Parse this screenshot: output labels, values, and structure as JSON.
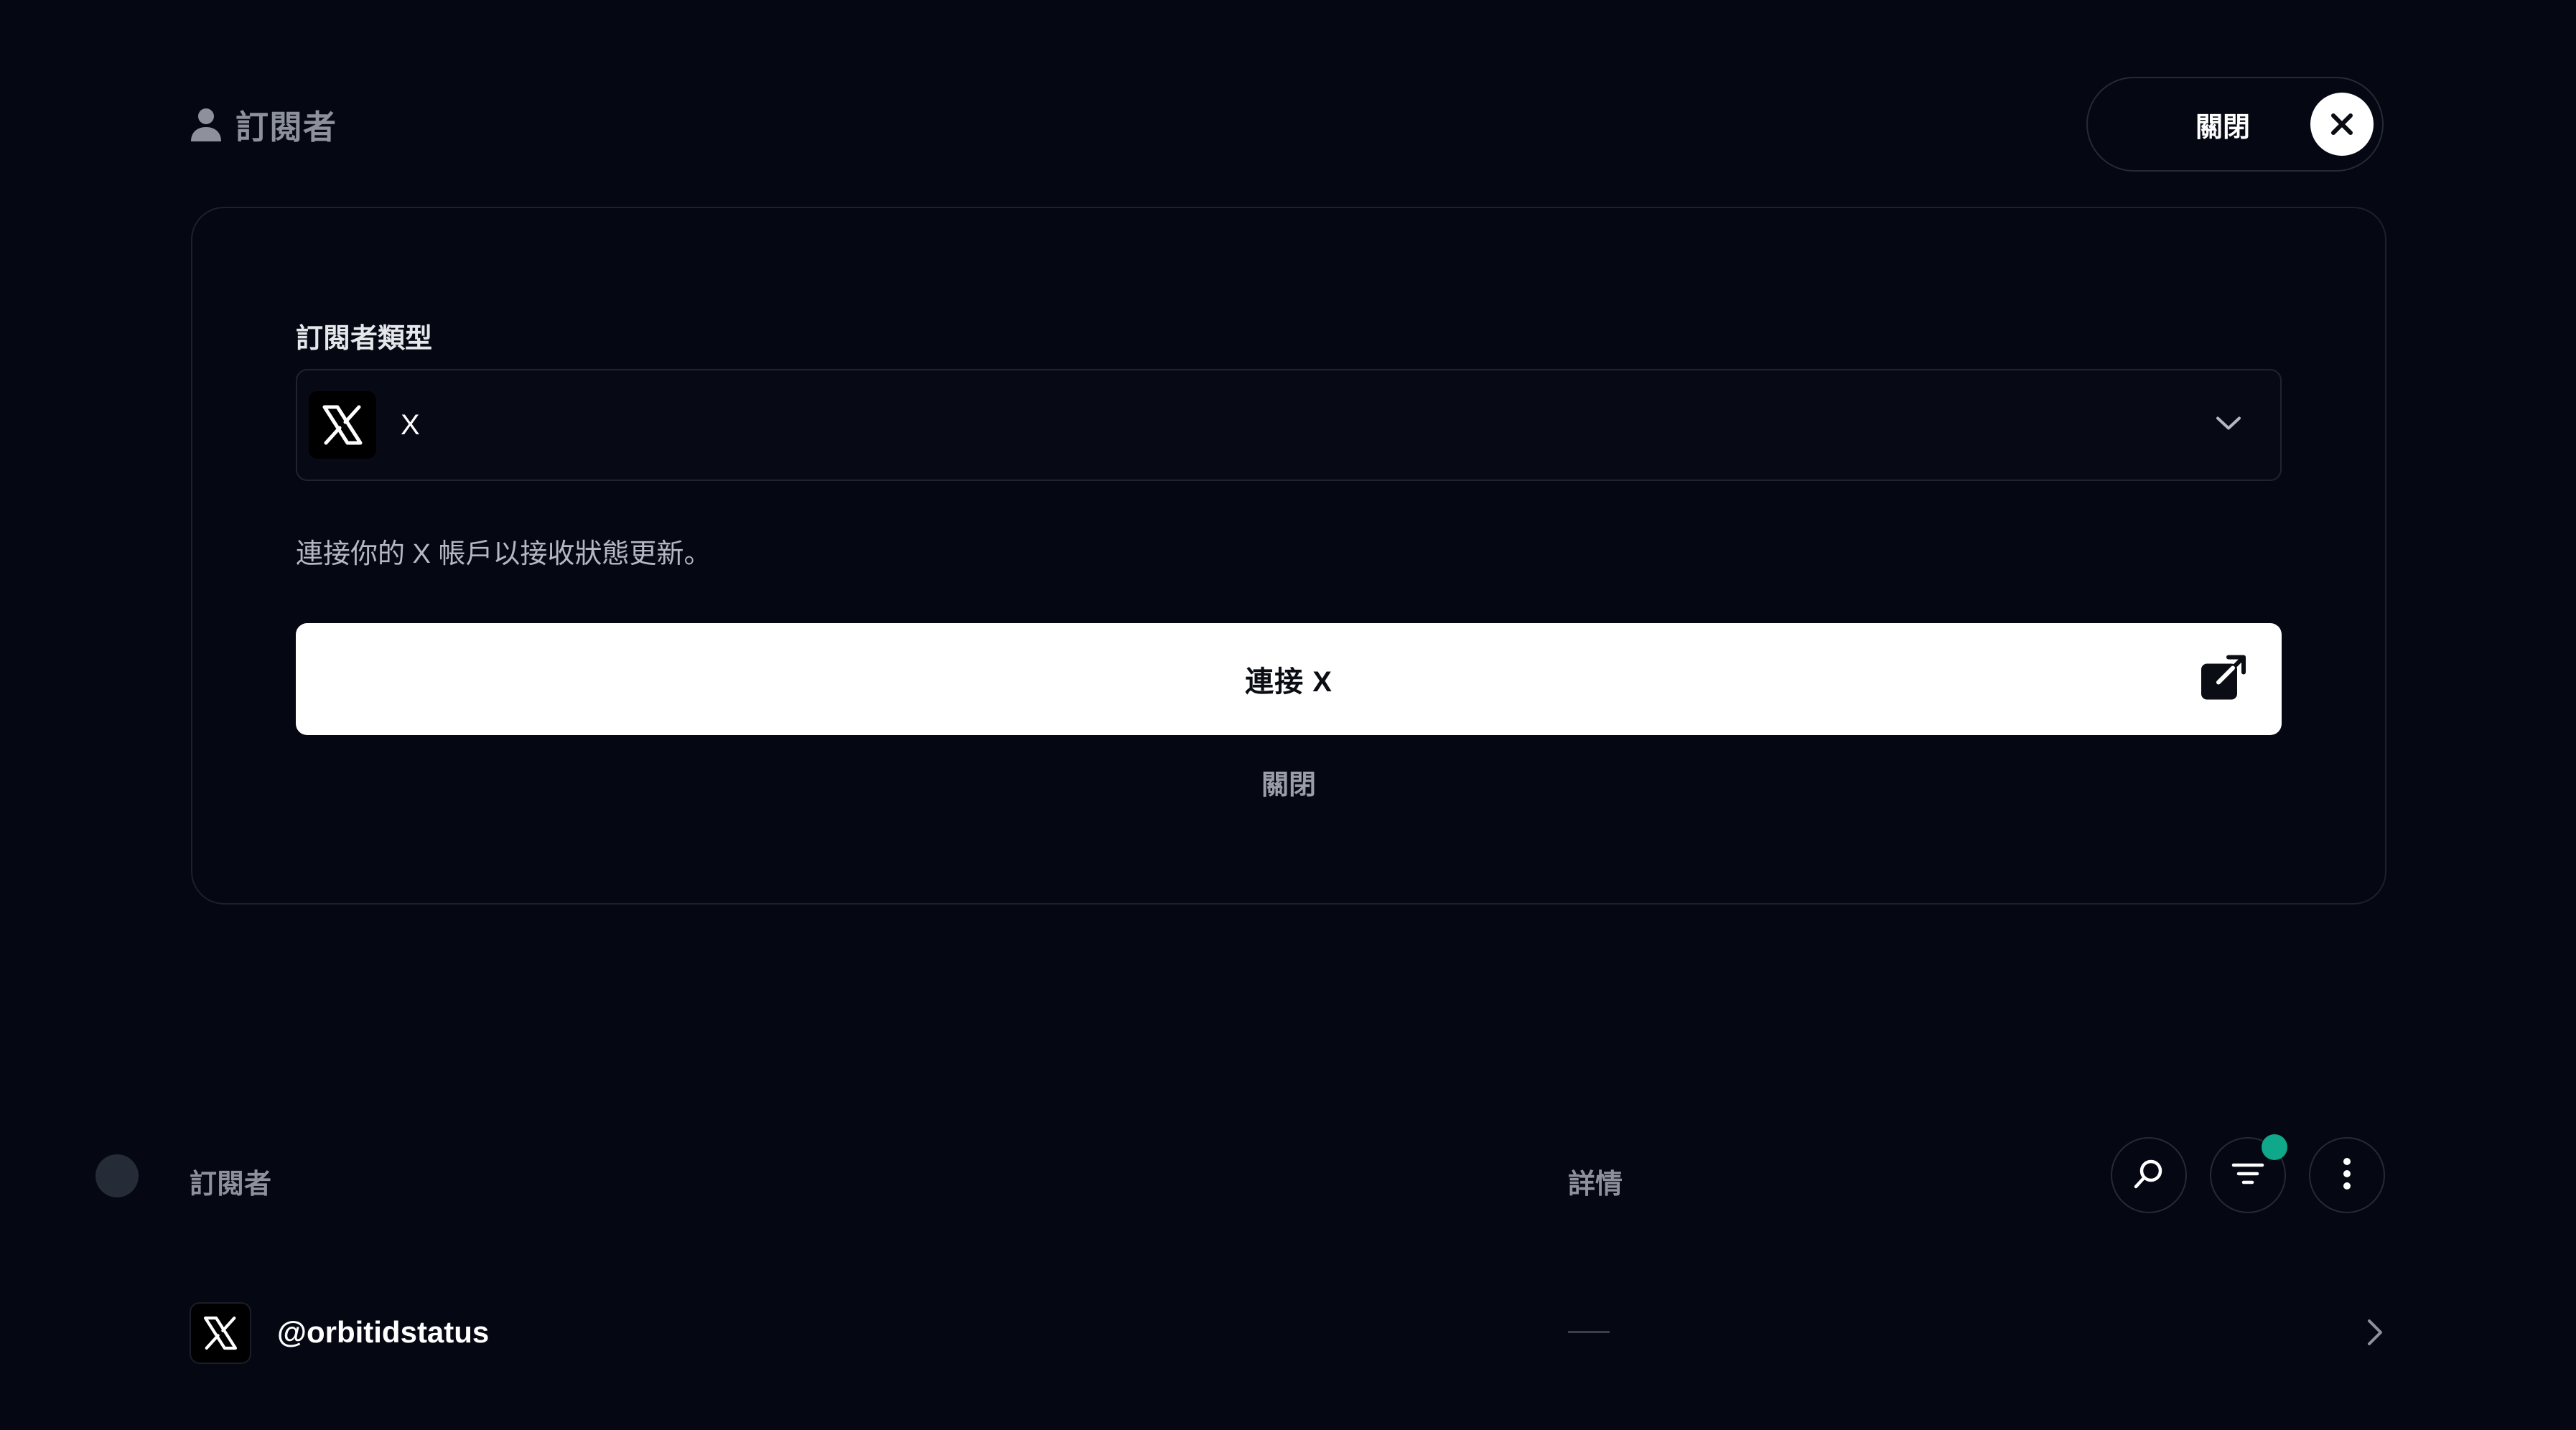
{
  "header": {
    "title": "訂閱者",
    "close_label": "關閉"
  },
  "form": {
    "type_label": "訂閱者類型",
    "selected_type": "X",
    "help_text": "連接你的 X 帳戶以接收狀態更新。",
    "connect_label": "連接 X",
    "secondary_close_label": "關閉"
  },
  "table": {
    "columns": {
      "subscriber": "訂閱者",
      "details": "詳情"
    },
    "rows": [
      {
        "handle": "@orbitidstatus",
        "details": "—"
      }
    ]
  },
  "colors": {
    "background": "#050813",
    "filter_active_dot": "#10a88a",
    "primary_button": "#ffffff"
  },
  "icons": {
    "header": "user-icon",
    "close": "close-icon",
    "type": "x-logo-icon",
    "dropdown": "chevron-down-icon",
    "external": "external-link-icon",
    "search": "search-icon",
    "filter": "filter-icon",
    "more": "more-vertical-icon",
    "row": "chevron-right-icon"
  }
}
